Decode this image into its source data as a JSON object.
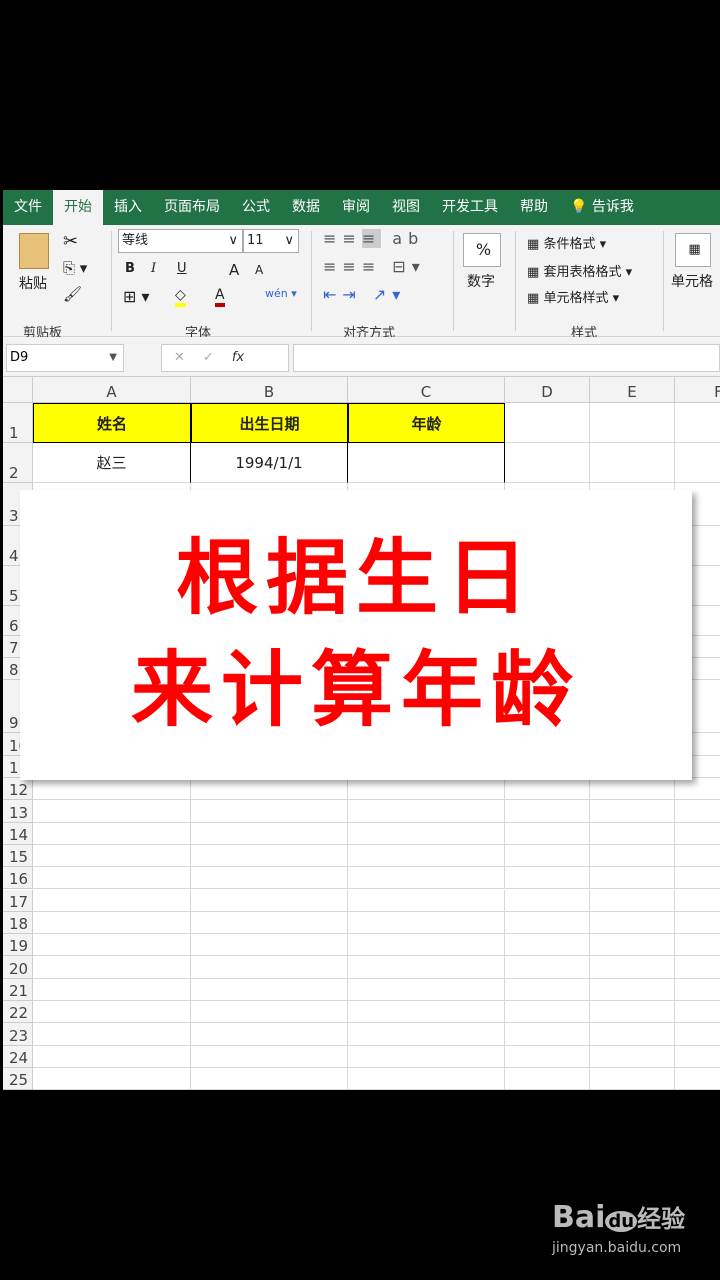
{
  "ribbon_tabs": [
    "文件",
    "开始",
    "插入",
    "页面布局",
    "公式",
    "数据",
    "审阅",
    "视图",
    "开发工具",
    "帮助",
    "告诉我"
  ],
  "active_tab": "开始",
  "clipboard": {
    "paste": "粘贴",
    "group": "剪贴板"
  },
  "font": {
    "name": "等线",
    "size": "11",
    "bold": "B",
    "italic": "I",
    "underline": "U",
    "grow": "A",
    "shrink": "A",
    "group": "字体",
    "fill_color": "#ffff00",
    "font_color": "#c00000"
  },
  "align": {
    "group": "对齐方式"
  },
  "number": {
    "symbol": "%",
    "label": "数字"
  },
  "styles": {
    "cond": "条件格式",
    "table": "套用表格格式",
    "cell": "单元格样式",
    "group": "样式"
  },
  "cells_group": "单元格",
  "name_box": "D9",
  "fx": "fx",
  "columns": [
    "A",
    "B",
    "C",
    "D",
    "E",
    "F"
  ],
  "rows": [
    "1",
    "2",
    "3",
    "4",
    "5",
    "6",
    "7",
    "8",
    "9",
    "10",
    "11",
    "12",
    "13",
    "14",
    "15",
    "16",
    "17",
    "18",
    "19",
    "20",
    "21",
    "22",
    "23",
    "24",
    "25"
  ],
  "table": {
    "headers": [
      "姓名",
      "出生日期",
      "年龄"
    ],
    "row2": [
      "赵三",
      "1994/1/1",
      ""
    ]
  },
  "overlay": {
    "line1": "根据生日",
    "line2": "来计算年龄",
    "color": "#ff0000"
  },
  "watermark": {
    "brand": "Bai",
    "du": "du",
    "jy": "经验",
    "url": "jingyan.baidu.com"
  }
}
